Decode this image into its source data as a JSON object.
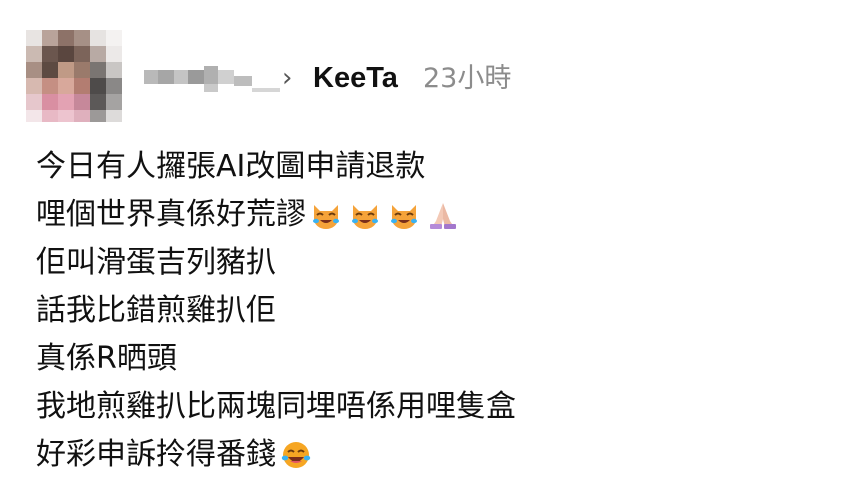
{
  "post": {
    "author": {
      "name_obscured": true
    },
    "separator": "›",
    "group_name": "KeeTa",
    "timestamp": "23小時",
    "lines": [
      {
        "text": "今日有人攞張AI改圖申請退款",
        "emojis": []
      },
      {
        "text": "哩個世界真係好荒謬",
        "emojis": [
          "crying-laughing-cat-emoji",
          "crying-laughing-cat-emoji",
          "crying-laughing-cat-emoji",
          "folded-hands-emoji"
        ]
      },
      {
        "text": "佢叫滑蛋吉列豬扒",
        "emojis": []
      },
      {
        "text": "話我比錯煎雞扒佢",
        "emojis": []
      },
      {
        "text": "真係R晒頭",
        "emojis": []
      },
      {
        "text": "我地煎雞扒比兩塊同埋唔係用哩隻盒",
        "emojis": []
      },
      {
        "text": "好彩申訴拎得番錢",
        "emojis": [
          "tears-of-joy-emoji"
        ]
      }
    ]
  },
  "colors": {
    "text": "#111111",
    "timestamp": "#8c8c8c",
    "chevron": "#555555",
    "emoji_face": "#f6a623",
    "cat_face": "#f5a33a",
    "hands": "#b58ad8"
  }
}
